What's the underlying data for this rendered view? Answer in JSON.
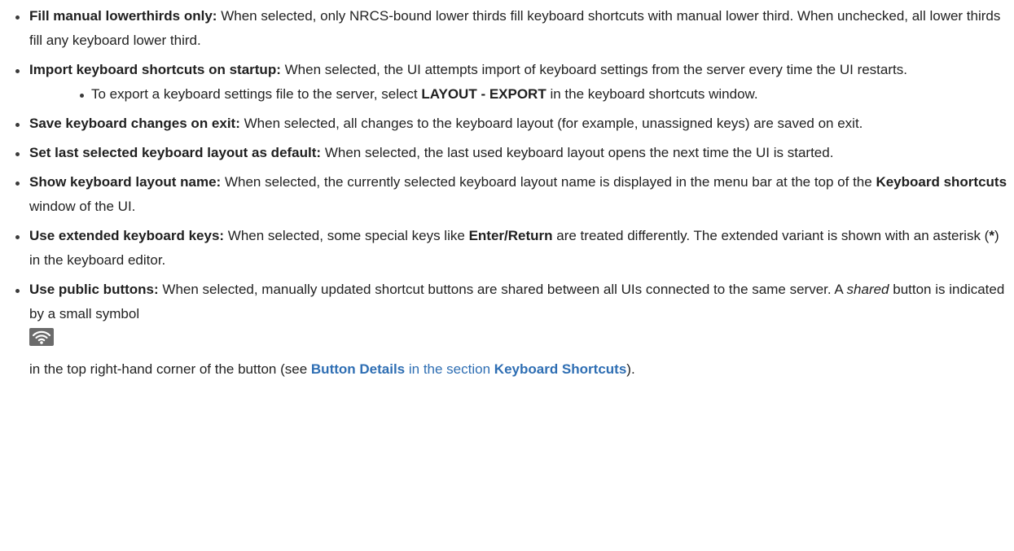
{
  "items": [
    {
      "title": "Fill manual lowerthirds only:",
      "text": "When selected, only NRCS-bound lower thirds fill keyboard shortcuts with manual lower third. When unchecked, all lower thirds fill any keyboard lower third."
    },
    {
      "title": "Import keyboard shortcuts on startup:",
      "text": "When selected, the UI attempts import of keyboard settings from the server every time the UI restarts.",
      "sub": {
        "pre": "To export a keyboard settings file to the server, select",
        "bold": "LAYOUT - EXPORT",
        "post": "in the keyboard shortcuts window."
      }
    },
    {
      "title": "Save keyboard changes on exit:",
      "text": "When selected, all changes to the keyboard layout (for example, unassigned keys) are saved on exit."
    },
    {
      "title": "Set last selected keyboard layout as default:",
      "text": "When selected, the last used keyboard layout opens the next time the UI is started."
    },
    {
      "title": "Show keyboard layout name:",
      "text_pre": "When selected, the currently selected keyboard layout name is displayed in the menu bar at the top of the",
      "text_bold": "Keyboard shortcuts",
      "text_post": "window of the UI."
    },
    {
      "title": "Use extended keyboard keys:",
      "text_pre": "When selected, some special keys like",
      "text_bold": "Enter/Return",
      "text_mid": "are treated differently. The extended variant is shown with an asterisk (",
      "text_bold2": "*",
      "text_post": ") in the keyboard editor."
    },
    {
      "title": "Use public buttons:",
      "text_pre": "When selected, manually updated shortcut buttons are shared between all UIs connected to the same server. A",
      "text_italic": "shared",
      "text_post": "button is indicated by a small symbol",
      "icon": "wifi-signal-icon",
      "after_icon_pre": "in the top right-hand corner of the button (see",
      "link1": "Button Details",
      "link_mid": "in the section",
      "link2": "Keyboard Shortcuts",
      "after_icon_post": ")."
    }
  ],
  "colors": {
    "text": "#222222",
    "link": "#2e6eb3",
    "icon_bg": "#6b6b6b"
  }
}
